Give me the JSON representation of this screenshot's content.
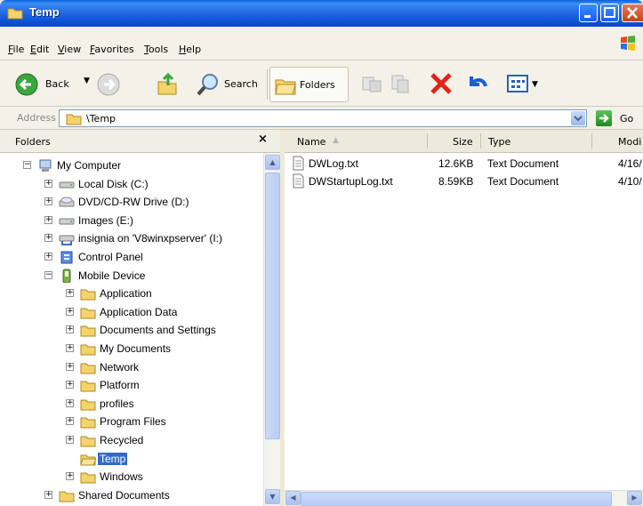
{
  "window": {
    "title": "Temp"
  },
  "menu": [
    "File",
    "Edit",
    "View",
    "Favorites",
    "Tools",
    "Help"
  ],
  "toolbar": {
    "back": "Back",
    "search": "Search",
    "folders": "Folders"
  },
  "address": {
    "label": "Address",
    "path": "\\Temp",
    "go": "Go"
  },
  "folders_pane": {
    "title": "Folders",
    "close": "×",
    "tree": [
      {
        "label": "My Computer",
        "icon": "my-computer-icon",
        "level": 0,
        "expander": "−"
      },
      {
        "label": "Local Disk (C:)",
        "icon": "drive-icon",
        "level": 1,
        "expander": "+"
      },
      {
        "label": "DVD/CD-RW Drive (D:)",
        "icon": "cd-drive-icon",
        "level": 1,
        "expander": "+"
      },
      {
        "label": "Images (E:)",
        "icon": "drive-icon",
        "level": 1,
        "expander": "+"
      },
      {
        "label": "insignia on 'V8winxpserver' (I:)",
        "icon": "network-drive-icon",
        "level": 1,
        "expander": "+"
      },
      {
        "label": "Control Panel",
        "icon": "control-panel-icon",
        "level": 1,
        "expander": "+"
      },
      {
        "label": "Mobile Device",
        "icon": "mobile-device-icon",
        "level": 1,
        "expander": "−"
      },
      {
        "label": "Application",
        "icon": "folder-icon",
        "level": 2,
        "expander": "+"
      },
      {
        "label": "Application Data",
        "icon": "folder-icon",
        "level": 2,
        "expander": "+"
      },
      {
        "label": "Documents and Settings",
        "icon": "folder-icon",
        "level": 2,
        "expander": "+"
      },
      {
        "label": "My Documents",
        "icon": "folder-icon",
        "level": 2,
        "expander": "+"
      },
      {
        "label": "Network",
        "icon": "folder-icon",
        "level": 2,
        "expander": "+"
      },
      {
        "label": "Platform",
        "icon": "folder-icon",
        "level": 2,
        "expander": "+"
      },
      {
        "label": "profiles",
        "icon": "folder-icon",
        "level": 2,
        "expander": "+"
      },
      {
        "label": "Program Files",
        "icon": "folder-icon",
        "level": 2,
        "expander": "+"
      },
      {
        "label": "Recycled",
        "icon": "folder-icon",
        "level": 2,
        "expander": "+"
      },
      {
        "label": "Temp",
        "icon": "open-folder-icon",
        "level": 2,
        "expander": "",
        "selected": true
      },
      {
        "label": "Windows",
        "icon": "folder-icon",
        "level": 2,
        "expander": "+"
      },
      {
        "label": "Shared Documents",
        "icon": "folder-icon",
        "level": 1,
        "expander": "+"
      }
    ]
  },
  "file_list": {
    "columns": [
      "Name",
      "Size",
      "Type",
      "Modi"
    ],
    "rows": [
      {
        "name": "DWLog.txt",
        "size": "12.6KB",
        "type": "Text Document",
        "modified": "4/16/"
      },
      {
        "name": "DWStartupLog.txt",
        "size": "8.59KB",
        "type": "Text Document",
        "modified": "4/10/"
      }
    ]
  },
  "colors": {
    "title_bar": "#0a5fe0",
    "selection": "#316ac5",
    "chrome": "#ece9d8"
  }
}
